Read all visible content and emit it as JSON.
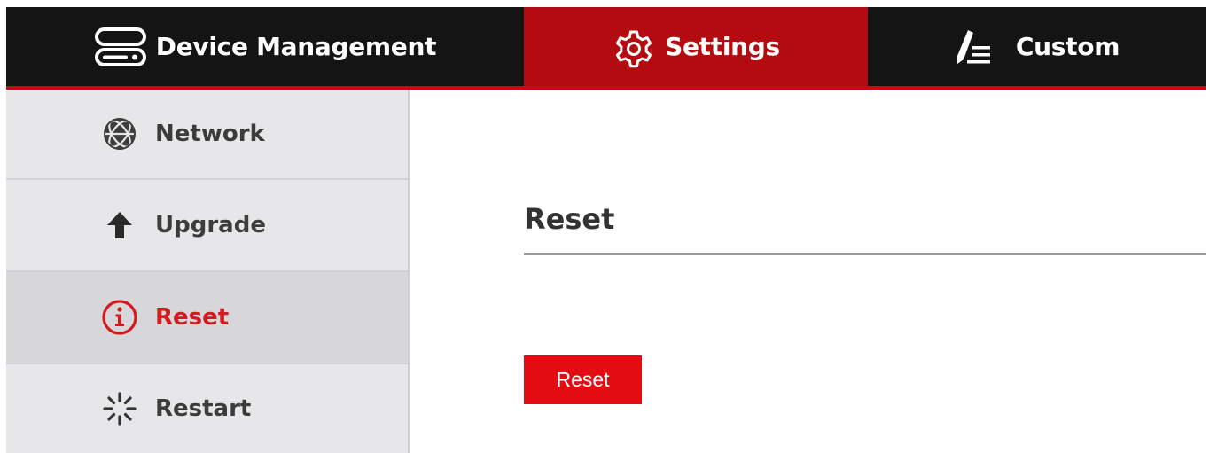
{
  "topnav": {
    "tabs": [
      {
        "label": "Device Management",
        "icon": "server-icon",
        "active": false
      },
      {
        "label": "Settings",
        "icon": "gear-icon",
        "active": true
      },
      {
        "label": "Custom",
        "icon": "pen-list-icon",
        "active": false
      }
    ]
  },
  "sidebar": {
    "items": [
      {
        "label": "Network",
        "icon": "globe-icon",
        "active": false
      },
      {
        "label": "Upgrade",
        "icon": "arrow-up-icon",
        "active": false
      },
      {
        "label": "Reset",
        "icon": "info-circle-icon",
        "active": true
      },
      {
        "label": "Restart",
        "icon": "spinner-icon",
        "active": false
      }
    ]
  },
  "main": {
    "title": "Reset",
    "reset_button_label": "Reset"
  },
  "colors": {
    "accent": "#c40c12",
    "active_tab": "#b30b0f",
    "button": "#e20c12",
    "nav_bg": "#141414",
    "sidebar_bg": "#e7e7e9"
  }
}
